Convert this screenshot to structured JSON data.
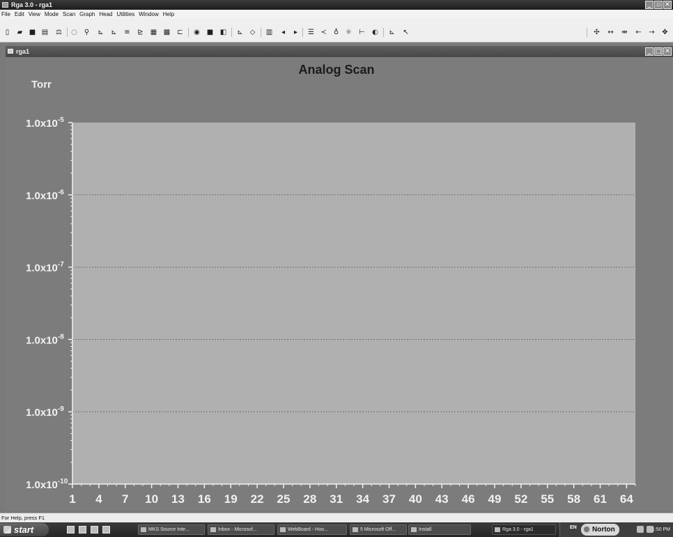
{
  "window": {
    "title": "Rga 3.0 - rga1",
    "controls": [
      "minimize",
      "restore",
      "close"
    ]
  },
  "menu": [
    "File",
    "Edit",
    "View",
    "Mode",
    "Scan",
    "Graph",
    "Head",
    "Utilities",
    "Window",
    "Help"
  ],
  "toolbar": {
    "left_icons": [
      "new-icon",
      "open-icon",
      "save-icon",
      "print-icon",
      "calibrate-icon",
      "scan-icon",
      "analyze-icon",
      "chart-bar-icon",
      "chart-area-icon",
      "chart-stack-icon",
      "chart-line-icon",
      "chart-table-icon",
      "grid-icon",
      "chart-step-icon",
      "record-icon",
      "stop-icon",
      "pause-icon",
      "trend-icon",
      "code-icon",
      "book-icon",
      "prev-icon",
      "next-icon",
      "list-icon",
      "filter-icon",
      "bulb-icon",
      "sun-icon",
      "peak-icon",
      "split-icon",
      "axes-icon",
      "help-pointer-icon"
    ],
    "right_icons": [
      "pan-icon",
      "expand-horizontal-icon",
      "compress-horizontal-icon",
      "scroll-left-icon",
      "scroll-right-icon",
      "move-icon"
    ]
  },
  "child_window": {
    "title": "rga1"
  },
  "chart_data": {
    "type": "line",
    "title": "Analog Scan",
    "y_unit_label": "Torr",
    "y_scale": "log",
    "ylim": [
      1e-10,
      1e-05
    ],
    "y_tick_labels": [
      {
        "base": "1.0x10",
        "exp": "-5",
        "value": 1e-05
      },
      {
        "base": "1.0x10",
        "exp": "-6",
        "value": 1e-06
      },
      {
        "base": "1.0x10",
        "exp": "-7",
        "value": 1e-07
      },
      {
        "base": "1.0x10",
        "exp": "-8",
        "value": 1e-08
      },
      {
        "base": "1.0x10",
        "exp": "-9",
        "value": 1e-09
      },
      {
        "base": "1.0x10",
        "exp": "-10",
        "value": 1e-10
      }
    ],
    "x_ticks": [
      "1",
      "4",
      "7",
      "10",
      "13",
      "16",
      "19",
      "22",
      "25",
      "28",
      "31",
      "34",
      "37",
      "40",
      "43",
      "46",
      "49",
      "52",
      "55",
      "58",
      "61",
      "64"
    ],
    "xlim": [
      1,
      65
    ],
    "grid": true,
    "series": []
  },
  "status": {
    "text": "For Help, press F1"
  },
  "taskbar": {
    "start_label": "start",
    "tasks": [
      "MKS Source Inte...",
      "Inbox - Microsof...",
      "WebBoard - Hoo...",
      "5 Microsoft Off...",
      "Install",
      "Rga 3.0 - rga1"
    ],
    "tray": {
      "lang": "EN",
      "norton": "Norton",
      "clock": "1:50 PM"
    }
  },
  "colors": {
    "plot_bg": "#b0b0b0",
    "panel_bg": "#7c7c7c",
    "axis": "#f2f2f2",
    "gridline": "#6e6e6e"
  }
}
